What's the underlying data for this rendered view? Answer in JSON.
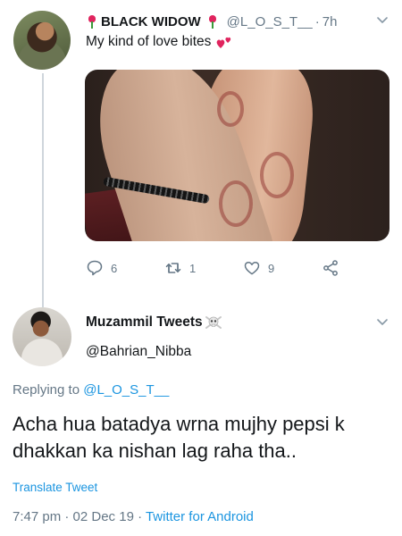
{
  "tweet1": {
    "display_name": "BLACK WIDOW",
    "handle": "@L_O_S_T__",
    "separator": "·",
    "time": "7h",
    "text": "My kind of love bites",
    "reply_count": "6",
    "retweet_count": "1",
    "like_count": "9",
    "icons": [
      "rose-icon",
      "hearts-emoji-icon",
      "reply-icon",
      "retweet-icon",
      "like-icon",
      "share-icon",
      "chevron-down-icon"
    ]
  },
  "tweet2": {
    "display_name": "Muzammil Tweets",
    "handle": "@Bahrian_Nibba",
    "replying_prefix": "Replying to",
    "replying_handle": "@L_O_S_T__",
    "text": "Acha hua batadya wrna mujhy pepsi k dhakkan ka nishan lag raha tha..",
    "translate_label": "Translate Tweet",
    "timestamp": "7:47 pm · 02 Dec 19 · ",
    "source": "Twitter for Android",
    "icons": [
      "skull-crossbones-icon",
      "chevron-down-icon"
    ]
  },
  "colors": {
    "text": "#14171a",
    "secondary": "#657786",
    "link": "#1b95e0",
    "thread_line": "#cfd6dc"
  }
}
